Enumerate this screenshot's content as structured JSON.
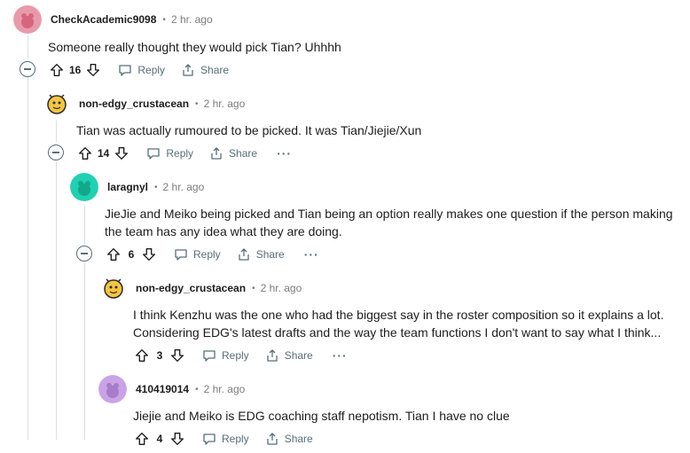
{
  "actions": {
    "reply": "Reply",
    "share": "Share",
    "more": "···"
  },
  "comments": [
    {
      "author": "CheckAcademic9098",
      "time": "2 hr. ago",
      "body": [
        "Someone really thought they would pick Tian? Uhhhh"
      ],
      "score": "16",
      "avatar_color": "#e89aab"
    },
    {
      "author": "non-edgy_crustacean",
      "time": "2 hr. ago",
      "body": [
        "Tian was actually rumoured to be picked. It was Tian/Jiejie/Xun"
      ],
      "score": "14",
      "avatar_color": "#f5c542"
    },
    {
      "author": "laragnyl",
      "time": "2 hr. ago",
      "body": [
        "JieJie and Meiko being picked and Tian being an option really makes one question if the person making",
        "the team has any idea what they are doing."
      ],
      "score": "6",
      "avatar_color": "#1fd1b1"
    },
    {
      "author": "non-edgy_crustacean",
      "time": "2 hr. ago",
      "body": [
        "I think Kenzhu was the one who had the biggest say in the roster composition so it explains a lot.",
        "Considering EDG's latest drafts and the way the team functions I don't want to say what I think..."
      ],
      "score": "3",
      "avatar_color": "#f5c542"
    },
    {
      "author": "410419014",
      "time": "2 hr. ago",
      "body": [
        "Jiejie and Meiko is EDG coaching staff nepotism. Tian I have no clue"
      ],
      "score": "4",
      "avatar_color": "#c9a3e6"
    }
  ]
}
